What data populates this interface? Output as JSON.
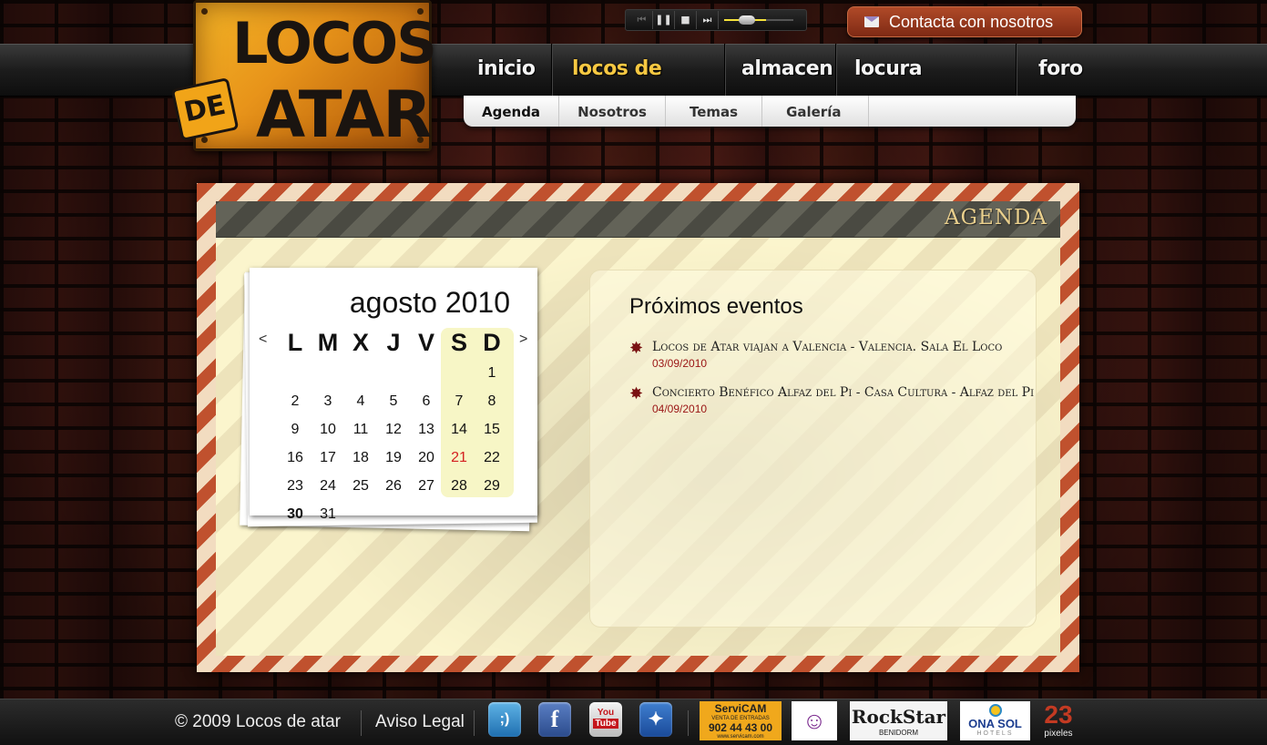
{
  "logo": {
    "line1": "LOCOS",
    "line2": "DE",
    "line3": "ATAR"
  },
  "player": {
    "buttons": [
      "⏮",
      "❚❚",
      "■",
      "⏭"
    ],
    "volume": 0.6
  },
  "contact": {
    "label": "Contacta con nosotros"
  },
  "menu": {
    "items": [
      {
        "label": "inicio"
      },
      {
        "label": "locos de atar",
        "active": true
      },
      {
        "label": "almacen"
      },
      {
        "label": "locura solidaria"
      },
      {
        "label": "foro"
      }
    ]
  },
  "submenu": {
    "items": [
      {
        "label": "Agenda",
        "active": true
      },
      {
        "label": "Nosotros"
      },
      {
        "label": "Temas"
      },
      {
        "label": "Galería"
      }
    ]
  },
  "section": {
    "title": "AGENDA"
  },
  "calendar": {
    "title": "agosto 2010",
    "prev": "<",
    "next": ">",
    "weekdays": [
      "L",
      "M",
      "X",
      "J",
      "V",
      "S",
      "D"
    ],
    "weeks": [
      [
        "",
        "",
        "",
        "",
        "",
        "",
        "1"
      ],
      [
        "2",
        "3",
        "4",
        "5",
        "6",
        "7",
        "8"
      ],
      [
        "9",
        "10",
        "11",
        "12",
        "13",
        "14",
        "15"
      ],
      [
        "16",
        "17",
        "18",
        "19",
        "20",
        "21",
        "22"
      ],
      [
        "23",
        "24",
        "25",
        "26",
        "27",
        "28",
        "29"
      ],
      [
        "30",
        "31",
        "",
        "",
        "",
        "",
        ""
      ]
    ],
    "today": "21",
    "bold_day": "30"
  },
  "events": {
    "title": "Próximos eventos",
    "items": [
      {
        "title": "Locos de Atar viajan a Valencia - Valencia. Sala El Loco",
        "date": "03/09/2010"
      },
      {
        "title": "Concierto Benéfico Alfaz del Pi - Casa Cultura - Alfaz del Pi",
        "date": "04/09/2010"
      }
    ]
  },
  "footer": {
    "copyright": "© 2009  Locos de atar",
    "legal": "Aviso Legal",
    "social": [
      "tuenti-icon",
      "facebook-icon",
      "youtube-icon",
      "myspace-icon"
    ],
    "sponsors": {
      "servicam": {
        "name": "ServiCAM",
        "sub": "VENTA DE ENTRADAS",
        "phone": "902 44 43 00",
        "url": "www.servicam.com"
      },
      "rockstar": {
        "name": "RockStar",
        "sub": "BENIDORM"
      },
      "onasol": {
        "name": "ONA SOL",
        "sub": "HOTELS"
      },
      "pixeles": {
        "num": "23",
        "sub": "pixeles"
      }
    }
  }
}
